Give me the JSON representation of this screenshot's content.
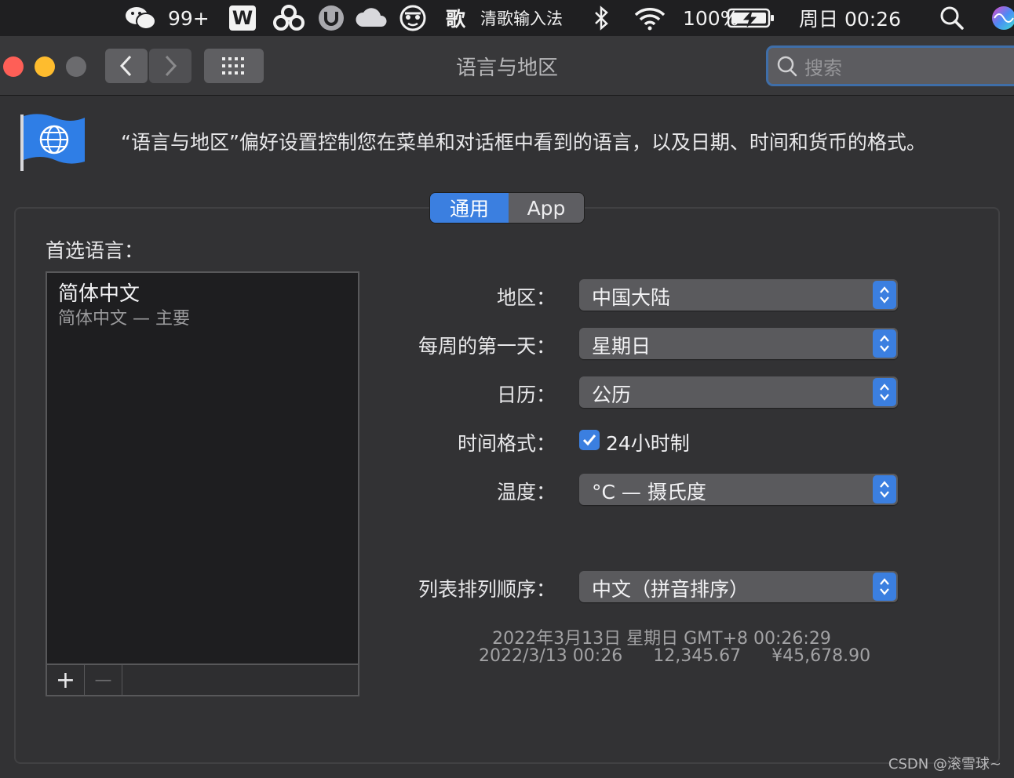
{
  "menubar": {
    "wechat_badge": "99+",
    "wps_label": "W",
    "input_method_glyph": "歌",
    "input_method_name": "清歌输入法",
    "battery_percent": "100%",
    "clock": "周日 00:26"
  },
  "window": {
    "title": "语言与地区",
    "search_placeholder": "搜索"
  },
  "header": {
    "description": "“语言与地区”偏好设置控制您在菜单和对话框中看到的语言，以及日期、时间和货币的格式。"
  },
  "tabs": [
    {
      "label": "通用",
      "selected": true
    },
    {
      "label": "App",
      "selected": false
    }
  ],
  "preferred_languages": {
    "label": "首选语言：",
    "items": [
      {
        "name": "简体中文",
        "subtitle": "简体中文 — 主要"
      }
    ],
    "add_label": "+",
    "remove_label": "—"
  },
  "settings": {
    "region_label": "地区：",
    "region_value": "中国大陆",
    "first_day_label": "每周的第一天：",
    "first_day_value": "星期日",
    "calendar_label": "日历：",
    "calendar_value": "公历",
    "time_format_label": "时间格式：",
    "time_format_checkbox": "24小时制",
    "time_format_checked": true,
    "temperature_label": "温度：",
    "temperature_value": "°C — 摄氏度",
    "sort_order_label": "列表排列顺序：",
    "sort_order_value": "中文（拼音排序）"
  },
  "samples": {
    "long_date": "2022年3月13日 星期日 GMT+8 00:26:29",
    "short_date": "2022/3/13 00:26",
    "number": "12,345.67",
    "currency": "¥45,678.90"
  },
  "watermark": "CSDN @滚雪球~",
  "colors": {
    "accent": "#3b7fe0",
    "background": "#323234",
    "menubar": "#1f1f21"
  }
}
